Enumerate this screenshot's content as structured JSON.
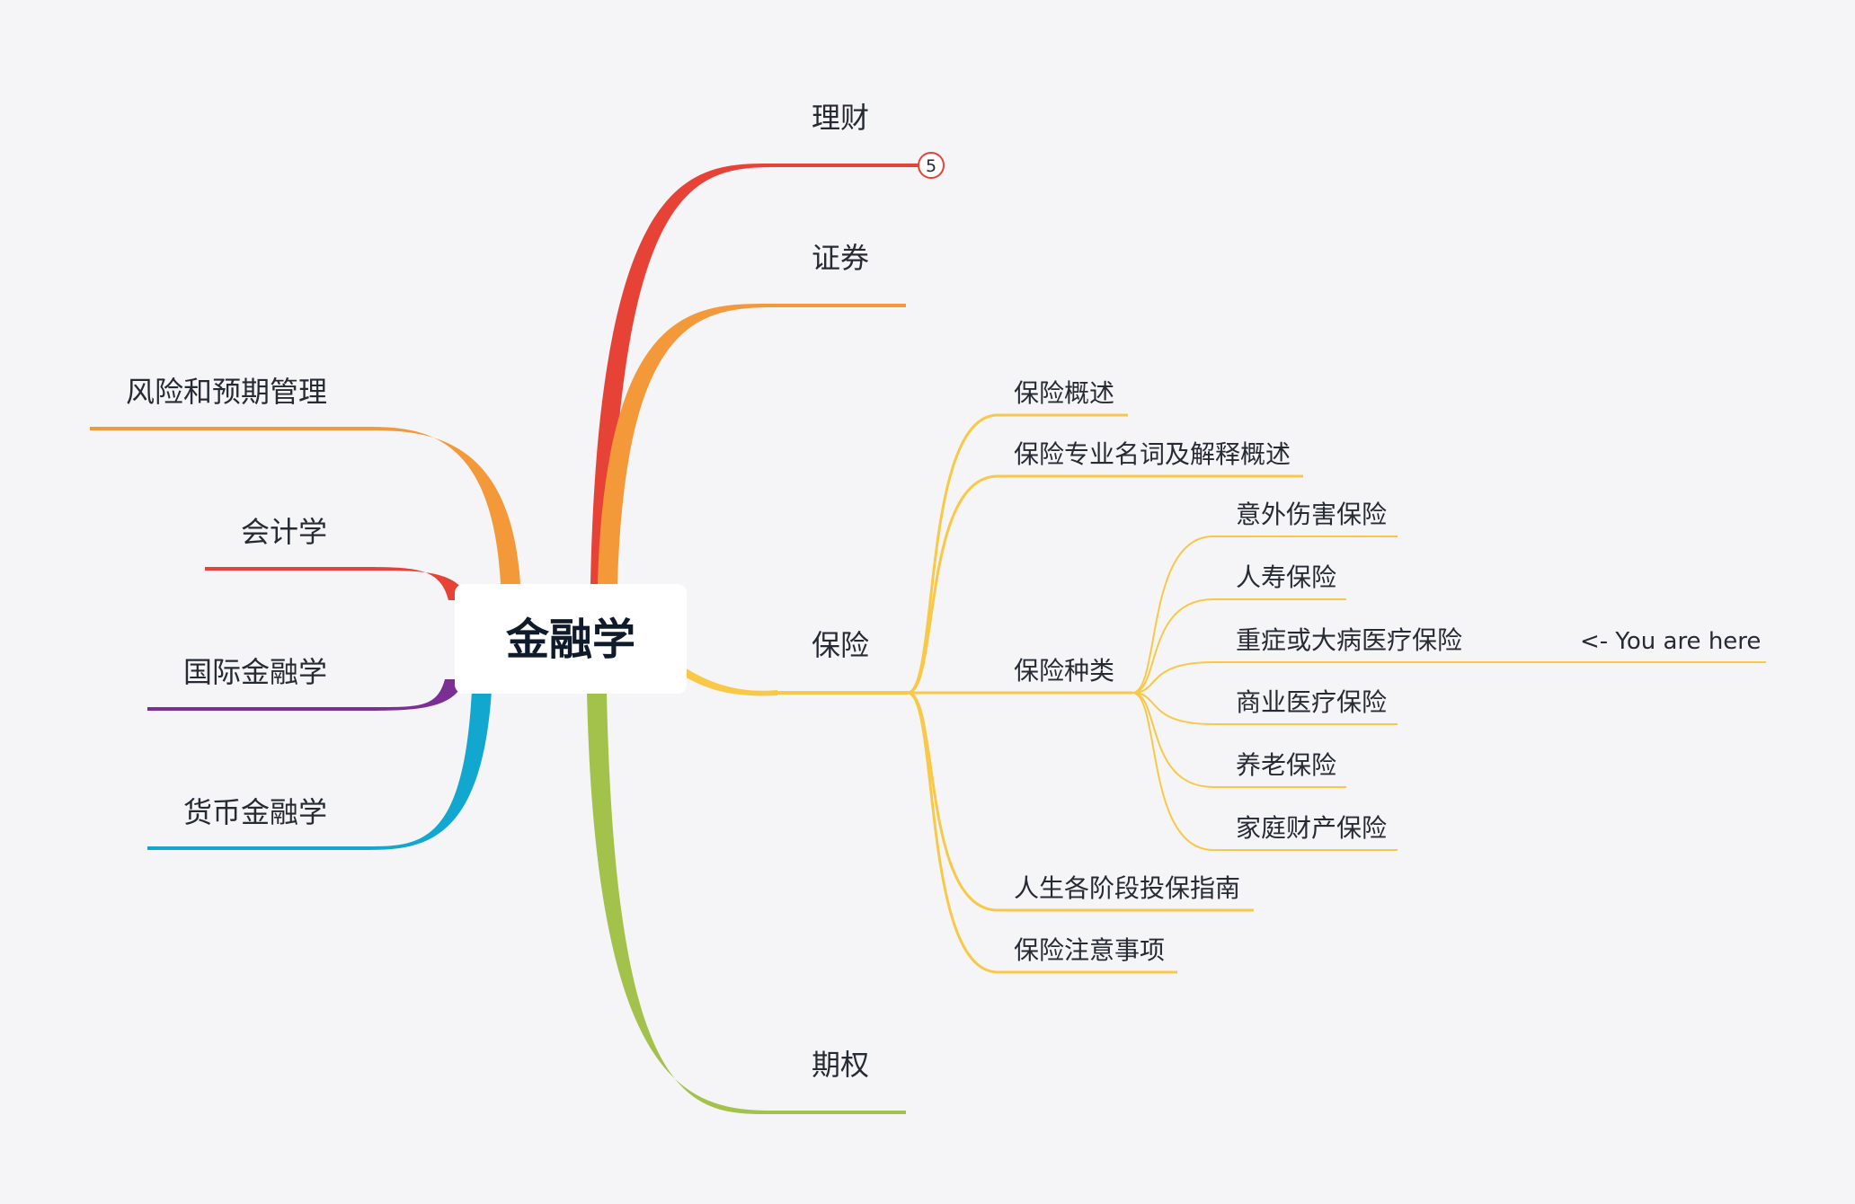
{
  "root": {
    "label": "金融学"
  },
  "colors": {
    "background": "#f5f5f8",
    "text": "#262a33",
    "root_text": "#0f1a2a",
    "red": "#e74236",
    "orange": "#f4993a",
    "yellow": "#f9c846",
    "green": "#a2c24b",
    "purple": "#7b2f95",
    "cyan": "#12a7cf"
  },
  "right_branches": [
    {
      "id": "licai",
      "label": "理财",
      "color": "red",
      "collapsed_count": "5"
    },
    {
      "id": "zhengquan",
      "label": "证券",
      "color": "orange"
    },
    {
      "id": "baoxian",
      "label": "保险",
      "color": "yellow"
    },
    {
      "id": "qiquan",
      "label": "期权",
      "color": "green"
    }
  ],
  "left_branches": [
    {
      "id": "fengxian",
      "label": "风险和预期管理",
      "color": "orange"
    },
    {
      "id": "kuaiji",
      "label": "会计学",
      "color": "red"
    },
    {
      "id": "guoji",
      "label": "国际金融学",
      "color": "purple"
    },
    {
      "id": "huobi",
      "label": "货币金融学",
      "color": "cyan"
    }
  ],
  "insurance_children": [
    {
      "id": "overview",
      "label": "保险概述"
    },
    {
      "id": "terms",
      "label": "保险专业名词及解释概述"
    },
    {
      "id": "types",
      "label": "保险种类"
    },
    {
      "id": "guide",
      "label": "人生各阶段投保指南"
    },
    {
      "id": "notes",
      "label": "保险注意事项"
    }
  ],
  "insurance_types": [
    {
      "id": "accident",
      "label": "意外伤害保险"
    },
    {
      "id": "life",
      "label": "人寿保险"
    },
    {
      "id": "critical",
      "label": "重症或大病医疗保险"
    },
    {
      "id": "commercial",
      "label": "商业医疗保险"
    },
    {
      "id": "pension",
      "label": "养老保险"
    },
    {
      "id": "property",
      "label": "家庭财产保险"
    }
  ],
  "marker": {
    "label": "<- You are here",
    "attached_to": "重症或大病医疗保险"
  }
}
